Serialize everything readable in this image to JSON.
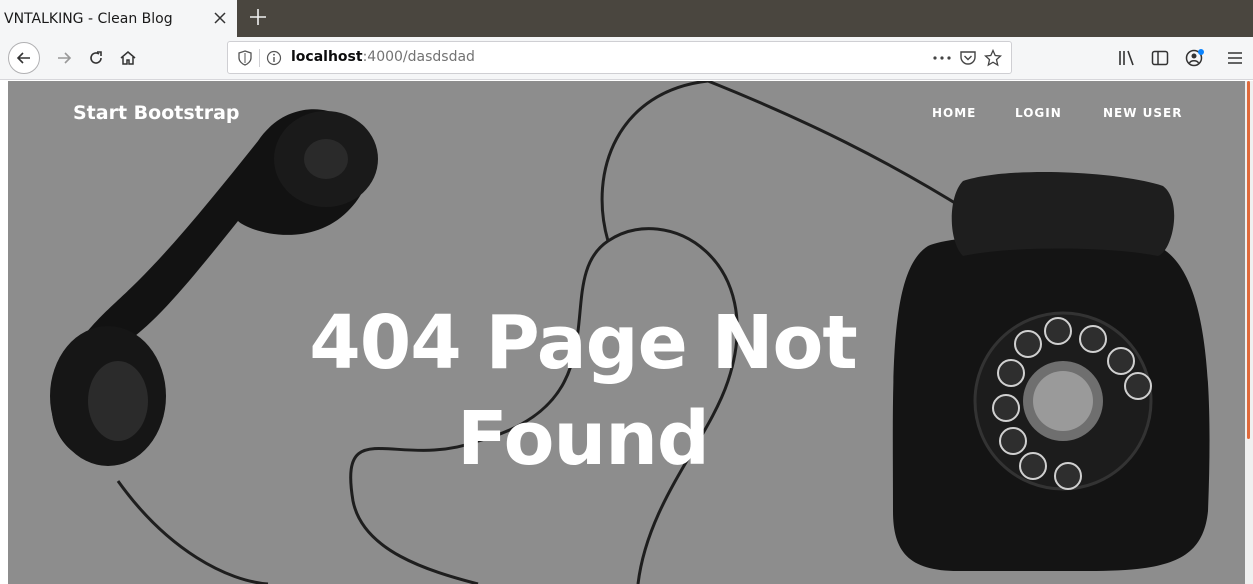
{
  "browser": {
    "tab_title": "VNTALKING - Clean Blog",
    "url_host": "localhost",
    "url_path": ":4000/dasdsdad"
  },
  "site": {
    "brand": "Start Bootstrap",
    "nav": [
      "HOME",
      "LOGIN",
      "NEW USER"
    ]
  },
  "hero": {
    "heading": "404 Page Not Found"
  },
  "colors": {
    "hero_overlay": "#8c8c8c",
    "tabbar": "#4a463f",
    "scroll_accent": "#e06a3b"
  },
  "icons": [
    "close-icon",
    "plus-icon",
    "back-icon",
    "forward-icon",
    "reload-icon",
    "home-icon",
    "shield-icon",
    "info-icon",
    "page-actions-icon",
    "pocket-icon",
    "star-icon",
    "library-icon",
    "sidebar-icon",
    "account-icon",
    "menu-icon"
  ]
}
